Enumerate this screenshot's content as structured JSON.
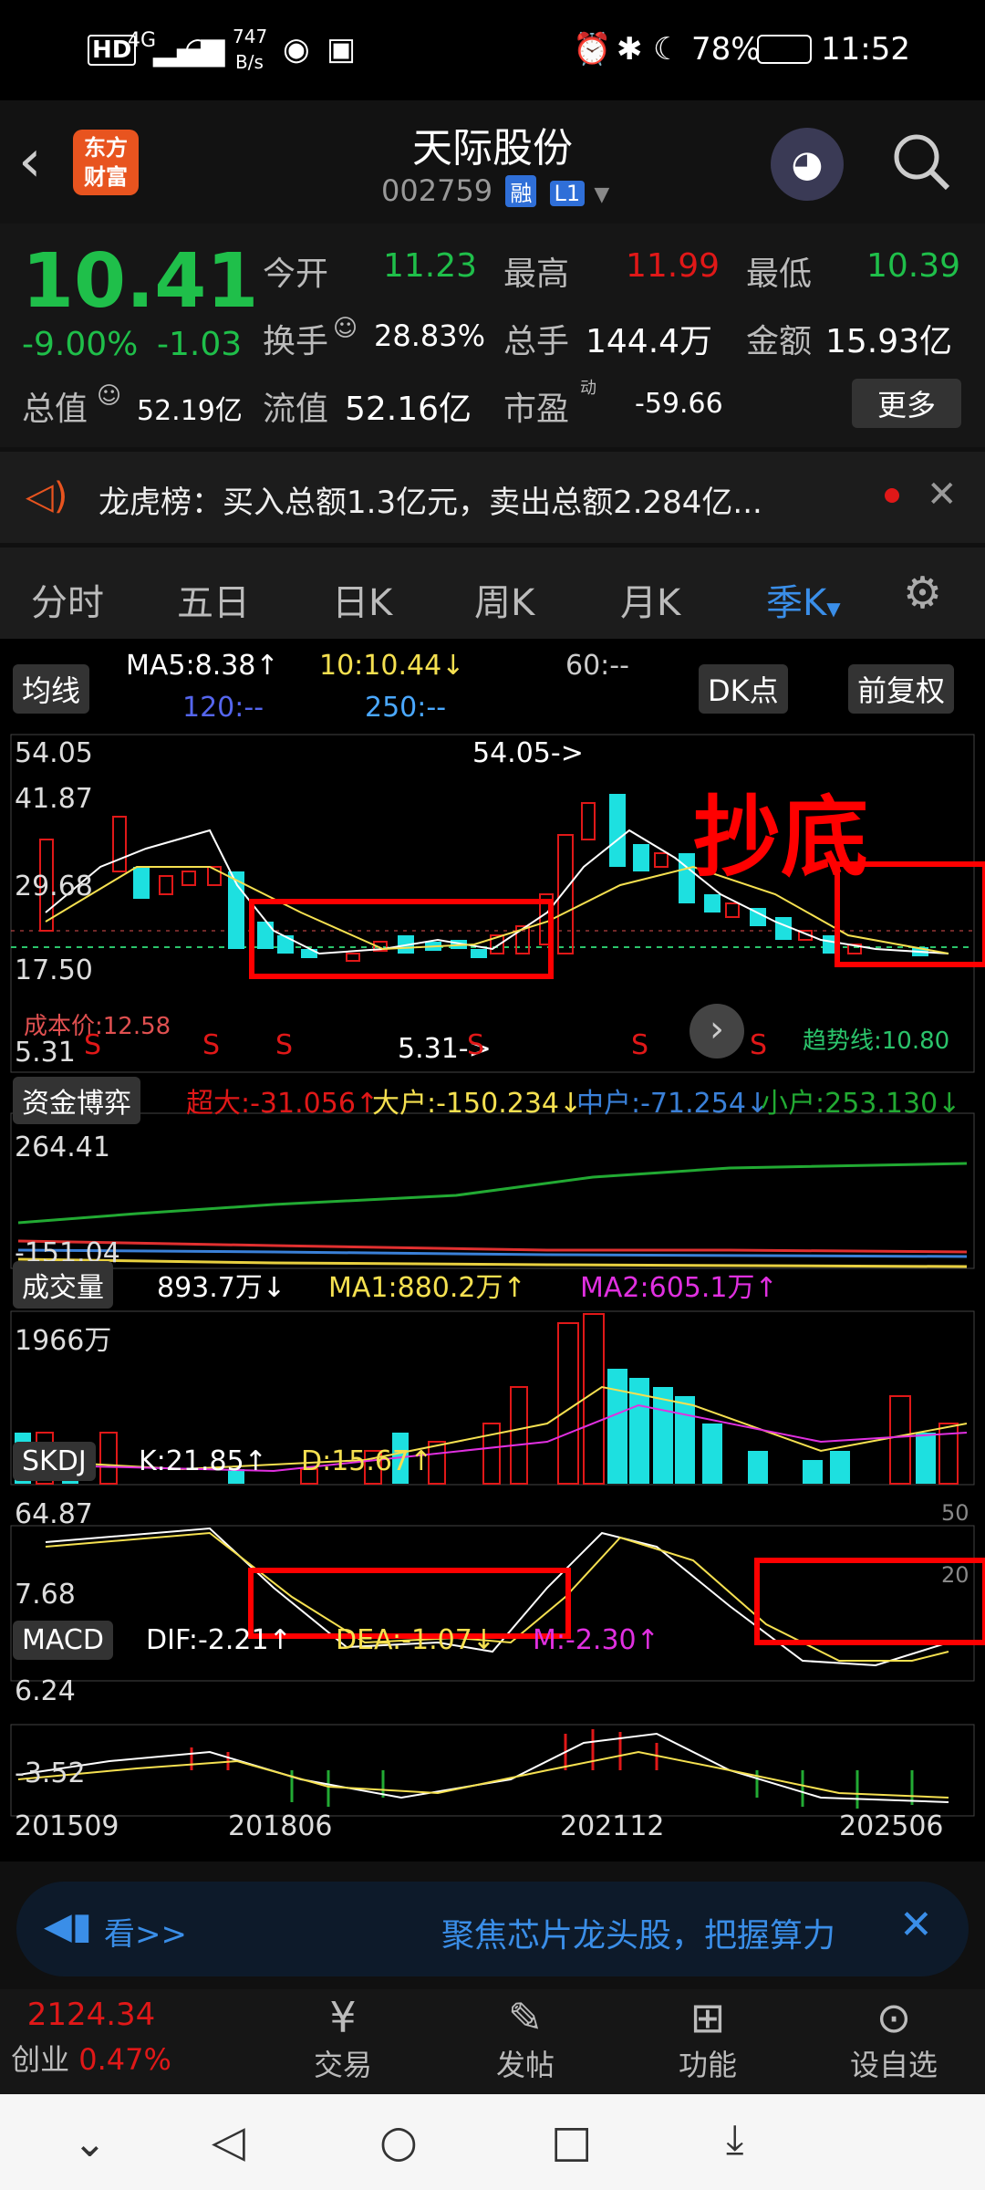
{
  "status": {
    "network": "4G",
    "speed_value": "747",
    "speed_unit": "B/s",
    "battery": "78%",
    "time": "11:52"
  },
  "header": {
    "logo_line1": "东方",
    "logo_line2": "财富",
    "name": "天际股份",
    "code": "002759",
    "badge_margin": "融",
    "badge_level": "L1"
  },
  "quote": {
    "price": "10.41",
    "change_pct": "-9.00%",
    "change": "-1.03",
    "open_label": "今开",
    "open": "11.23",
    "high_label": "最高",
    "high": "11.99",
    "low_label": "最低",
    "low": "10.39",
    "turnover_label": "换手",
    "turnover": "28.83%",
    "volume_label": "总手",
    "volume": "144.4万",
    "amount_label": "金额",
    "amount": "15.93亿",
    "mcap_label": "总值",
    "mcap": "52.19亿",
    "float_label": "流值",
    "float_cap": "52.16亿",
    "pe_label": "市盈",
    "pe_sup": "动",
    "pe": "-59.66",
    "more": "更多"
  },
  "news": {
    "text": "龙虎榜：买入总额1.3亿元，卖出总额2.284亿..."
  },
  "tabs": [
    "分时",
    "五日",
    "日K",
    "周K",
    "月K",
    "季K"
  ],
  "active_tab_index": 5,
  "ma_bar": {
    "select": "均线",
    "ma5": "MA5:8.38↑",
    "ma10": "10:10.44↓",
    "ma60": "60:--",
    "ma120": "120:--",
    "ma250": "250:--",
    "dk": "DK点",
    "adjust": "前复权"
  },
  "main_chart": {
    "ymax_label": "54.05",
    "y2_label": "41.87",
    "y3_label": "29.68",
    "y4_label": "17.50",
    "ymin_label": "5.31",
    "peak_label": "54.05->",
    "low_label": "5.31->",
    "cost_label": "成本价:12.58",
    "signal_label": "趋势线:10.80",
    "annotation": "抄底",
    "sell_marks": [
      "S",
      "S",
      "S",
      "S",
      "S",
      "S"
    ]
  },
  "fund": {
    "select": "资金博弈",
    "super": "超大:-31.056↑",
    "large": "大户:-150.234↓",
    "mid": "中户:-71.254↓",
    "small": "小户:253.130↓",
    "ymax": "264.41",
    "ymin": "-151.04"
  },
  "volume": {
    "select": "成交量",
    "value": "893.7万↓",
    "ma1": "MA1:880.2万↑",
    "ma2": "MA2:605.1万↑",
    "ymax": "1966万"
  },
  "skdj": {
    "select": "SKDJ",
    "k": "K:21.85↑",
    "d": "D:15.67↑",
    "ymax": "64.87",
    "ymin": "7.68",
    "ref50": "50",
    "ref20": "20"
  },
  "macd": {
    "select": "MACD",
    "dif": "DIF:-2.21↑",
    "dea": "DEA:-1.07↓",
    "m": "M:-2.30↑",
    "ymax": "6.24",
    "ymin": "-3.52"
  },
  "x_axis": [
    "201509",
    "201806",
    "202112",
    "202506"
  ],
  "ad": {
    "left": "看>>",
    "text": "聚焦芯片龙头股，把握算力"
  },
  "bottom_nav": {
    "index_value": "2124.34",
    "index_name": "创业",
    "index_change": "0.47%",
    "trade": "交易",
    "post": "发帖",
    "function": "功能",
    "watchlist": "设自选"
  },
  "colors": {
    "up": "#e01818",
    "down": "#1fbf4a",
    "accent": "#1e88e5",
    "annotation": "#ff0000"
  }
}
